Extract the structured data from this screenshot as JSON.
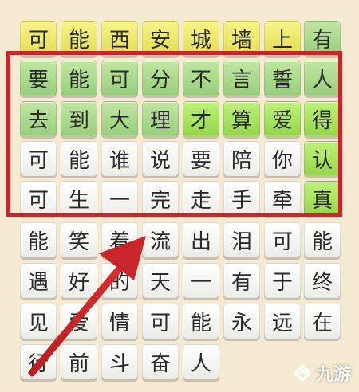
{
  "grid": {
    "rows": [
      [
        {
          "char": "可",
          "color": "yellow"
        },
        {
          "char": "能",
          "color": "yellow"
        },
        {
          "char": "西",
          "color": "yellow"
        },
        {
          "char": "安",
          "color": "yellow"
        },
        {
          "char": "城",
          "color": "yellow"
        },
        {
          "char": "墙",
          "color": "yellow"
        },
        {
          "char": "上",
          "color": "yellow"
        },
        {
          "char": "有",
          "color": "green"
        }
      ],
      [
        {
          "char": "要",
          "color": "green"
        },
        {
          "char": "能",
          "color": "green"
        },
        {
          "char": "可",
          "color": "green"
        },
        {
          "char": "分",
          "color": "green"
        },
        {
          "char": "不",
          "color": "green"
        },
        {
          "char": "言",
          "color": "green"
        },
        {
          "char": "誓",
          "color": "green"
        },
        {
          "char": "人",
          "color": "green"
        }
      ],
      [
        {
          "char": "去",
          "color": "green"
        },
        {
          "char": "到",
          "color": "green"
        },
        {
          "char": "大",
          "color": "green"
        },
        {
          "char": "理",
          "color": "green"
        },
        {
          "char": "才",
          "color": "lime"
        },
        {
          "char": "算",
          "color": "lime"
        },
        {
          "char": "爱",
          "color": "lime"
        },
        {
          "char": "得",
          "color": "lime"
        }
      ],
      [
        {
          "char": "可",
          "color": "white"
        },
        {
          "char": "能",
          "color": "white"
        },
        {
          "char": "谁",
          "color": "white"
        },
        {
          "char": "说",
          "color": "white"
        },
        {
          "char": "要",
          "color": "white"
        },
        {
          "char": "陪",
          "color": "white"
        },
        {
          "char": "你",
          "color": "white"
        },
        {
          "char": "认",
          "color": "lime"
        }
      ],
      [
        {
          "char": "可",
          "color": "white"
        },
        {
          "char": "生",
          "color": "white"
        },
        {
          "char": "一",
          "color": "white"
        },
        {
          "char": "完",
          "color": "white"
        },
        {
          "char": "走",
          "color": "white"
        },
        {
          "char": "手",
          "color": "white"
        },
        {
          "char": "牵",
          "color": "white"
        },
        {
          "char": "真",
          "color": "lime"
        }
      ],
      [
        {
          "char": "能",
          "color": "white"
        },
        {
          "char": "笑",
          "color": "white"
        },
        {
          "char": "着",
          "color": "white"
        },
        {
          "char": "流",
          "color": "white"
        },
        {
          "char": "出",
          "color": "white"
        },
        {
          "char": "泪",
          "color": "white"
        },
        {
          "char": "可",
          "color": "white"
        },
        {
          "char": "能",
          "color": "white"
        }
      ],
      [
        {
          "char": "遇",
          "color": "white"
        },
        {
          "char": "好",
          "color": "white"
        },
        {
          "char": "的",
          "color": "white"
        },
        {
          "char": "天",
          "color": "white"
        },
        {
          "char": "一",
          "color": "white"
        },
        {
          "char": "有",
          "color": "white"
        },
        {
          "char": "于",
          "color": "white"
        },
        {
          "char": "终",
          "color": "white"
        }
      ],
      [
        {
          "char": "见",
          "color": "white"
        },
        {
          "char": "爱",
          "color": "white"
        },
        {
          "char": "情",
          "color": "white"
        },
        {
          "char": "可",
          "color": "white"
        },
        {
          "char": "能",
          "color": "white"
        },
        {
          "char": "永",
          "color": "white"
        },
        {
          "char": "远",
          "color": "white"
        },
        {
          "char": "在",
          "color": "white"
        }
      ],
      [
        {
          "char": "行",
          "color": "white"
        },
        {
          "char": "前",
          "color": "white"
        },
        {
          "char": "斗",
          "color": "white"
        },
        {
          "char": "奋",
          "color": "white"
        },
        {
          "char": "人",
          "color": "white"
        },
        {
          "char": "",
          "color": "none"
        },
        {
          "char": "",
          "color": "none"
        },
        {
          "char": "",
          "color": "none"
        }
      ]
    ]
  },
  "colors": {
    "highlight_border": "#c8262a",
    "arrow": "#c8262a"
  },
  "watermark": {
    "text": "九游",
    "icon": "jiuyou-logo-icon"
  }
}
